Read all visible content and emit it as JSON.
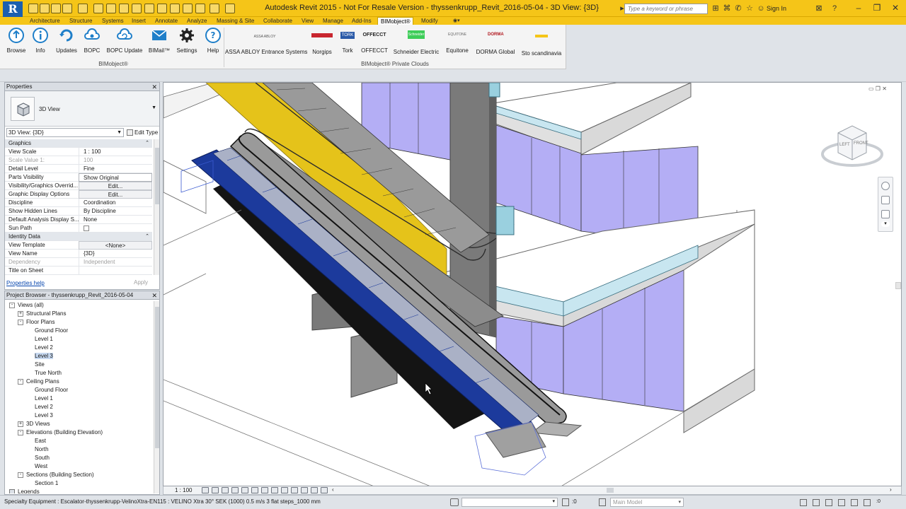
{
  "title_bar": {
    "title": "Autodesk Revit 2015 - Not For Resale Version -      thyssenkrupp_Revit_2016-05-04 - 3D View: {3D}",
    "search_placeholder": "Type a keyword or phrase",
    "sign_in": "Sign In",
    "app_logo_letter": "R"
  },
  "ribbon_tabs": [
    {
      "label": "Architecture"
    },
    {
      "label": "Structure"
    },
    {
      "label": "Systems"
    },
    {
      "label": "Insert"
    },
    {
      "label": "Annotate"
    },
    {
      "label": "Analyze"
    },
    {
      "label": "Massing & Site"
    },
    {
      "label": "Collaborate"
    },
    {
      "label": "View"
    },
    {
      "label": "Manage"
    },
    {
      "label": "Add-Ins"
    },
    {
      "label": "BIMobject®",
      "active": true
    },
    {
      "label": "Modify"
    }
  ],
  "ribbon": {
    "panel1_title": "BIMobject®",
    "panel2_title": "BIMobject® Private Clouds",
    "buttons": [
      {
        "label": "Browse",
        "icon": "cloud-up-icon"
      },
      {
        "label": "Info",
        "icon": "info-icon"
      },
      {
        "label": "Updates",
        "icon": "refresh-icon"
      },
      {
        "label": "BOPC",
        "icon": "cloud-icon"
      },
      {
        "label": "BOPC Update",
        "icon": "cloud-refresh-icon"
      },
      {
        "label": "BIMail™",
        "icon": "mail-icon"
      },
      {
        "label": "Settings",
        "icon": "gear-icon"
      },
      {
        "label": "Help",
        "icon": "help-icon"
      }
    ],
    "brands": [
      {
        "label": "ASSA ABLOY Entrance Systems",
        "logo": "ASSA ABLOY"
      },
      {
        "label": "Norgips",
        "logo": "norgips"
      },
      {
        "label": "Tork",
        "logo": "TORK"
      },
      {
        "label": "OFFECCT",
        "logo": "OFFECCT"
      },
      {
        "label": "Schneider Electric",
        "logo": "Schneider"
      },
      {
        "label": "Equitone",
        "logo": "EQUITONE"
      },
      {
        "label": "DORMA Global",
        "logo": "DORMA"
      },
      {
        "label": "Sto scandinavia",
        "logo": "sto"
      }
    ]
  },
  "properties": {
    "header": "Properties",
    "type_name": "3D View",
    "instance": "3D View: {3D}",
    "edit_type": "Edit Type",
    "help_link": "Properties help",
    "apply": "Apply",
    "rows": [
      {
        "kind": "group",
        "name": "Graphics"
      },
      {
        "name": "View Scale",
        "value": "1 : 100"
      },
      {
        "name": "Scale Value    1:",
        "value": "100",
        "grey": true
      },
      {
        "name": "Detail Level",
        "value": "Fine"
      },
      {
        "name": "Parts Visibility",
        "value": "Show Original",
        "boxed": true
      },
      {
        "name": "Visibility/Graphics Overrid...",
        "value": "Edit...",
        "btn": true
      },
      {
        "name": "Graphic Display Options",
        "value": "Edit...",
        "btn": true
      },
      {
        "name": "Discipline",
        "value": "Coordination"
      },
      {
        "name": "Show Hidden Lines",
        "value": "By Discipline"
      },
      {
        "name": "Default Analysis Display S...",
        "value": "None"
      },
      {
        "name": "Sun Path",
        "value": "",
        "checkbox": true
      },
      {
        "kind": "group",
        "name": "Identity Data"
      },
      {
        "name": "View Template",
        "value": "<None>",
        "btn": true
      },
      {
        "name": "View Name",
        "value": "{3D}"
      },
      {
        "name": "Dependency",
        "value": "Independent",
        "grey": true
      },
      {
        "name": "Title on Sheet",
        "value": ""
      }
    ]
  },
  "browser": {
    "header": "Project Browser - thyssenkrupp_Revit_2016-05-04",
    "nodes": [
      {
        "label": "Views (all)",
        "level": 0,
        "exp": "-"
      },
      {
        "label": "Structural Plans",
        "level": 1,
        "exp": "+"
      },
      {
        "label": "Floor Plans",
        "level": 1,
        "exp": "-"
      },
      {
        "label": "Ground Floor",
        "level": 2
      },
      {
        "label": "Level 1",
        "level": 2
      },
      {
        "label": "Level 2",
        "level": 2
      },
      {
        "label": "Level 3",
        "level": 2,
        "selected": true
      },
      {
        "label": "Site",
        "level": 2
      },
      {
        "label": "True North",
        "level": 2
      },
      {
        "label": "Ceiling Plans",
        "level": 1,
        "exp": "-"
      },
      {
        "label": "Ground Floor",
        "level": 2
      },
      {
        "label": "Level 1",
        "level": 2
      },
      {
        "label": "Level 2",
        "level": 2
      },
      {
        "label": "Level 3",
        "level": 2
      },
      {
        "label": "3D Views",
        "level": 1,
        "exp": "+"
      },
      {
        "label": "Elevations (Building Elevation)",
        "level": 1,
        "exp": "-"
      },
      {
        "label": "East",
        "level": 2
      },
      {
        "label": "North",
        "level": 2
      },
      {
        "label": "South",
        "level": 2
      },
      {
        "label": "West",
        "level": 2
      },
      {
        "label": "Sections (Building Section)",
        "level": 1,
        "exp": "-"
      },
      {
        "label": "Section 1",
        "level": 2
      },
      {
        "label": "Legends",
        "level": 0,
        "exp": ""
      }
    ]
  },
  "viewport": {
    "scale": "1 : 100",
    "viewcube_left": "LEFT",
    "viewcube_front": "FRONT"
  },
  "status": {
    "text": "Specialty Equipment : Escalator-thyssenkrupp-VelinoXtra-EN115 : VELINO Xtra 30° SEK (1000) 0.5 m/s 3 flat steps_1000 mm",
    "zero": ":0",
    "model": "Main Model"
  },
  "colors": {
    "title_bar": "#f5c518",
    "escalator_blue": "#1c3a9c",
    "escalator_yellow": "#e5c31a",
    "glass": "#b4aef5",
    "slab_edge": "#c8e6f0"
  }
}
